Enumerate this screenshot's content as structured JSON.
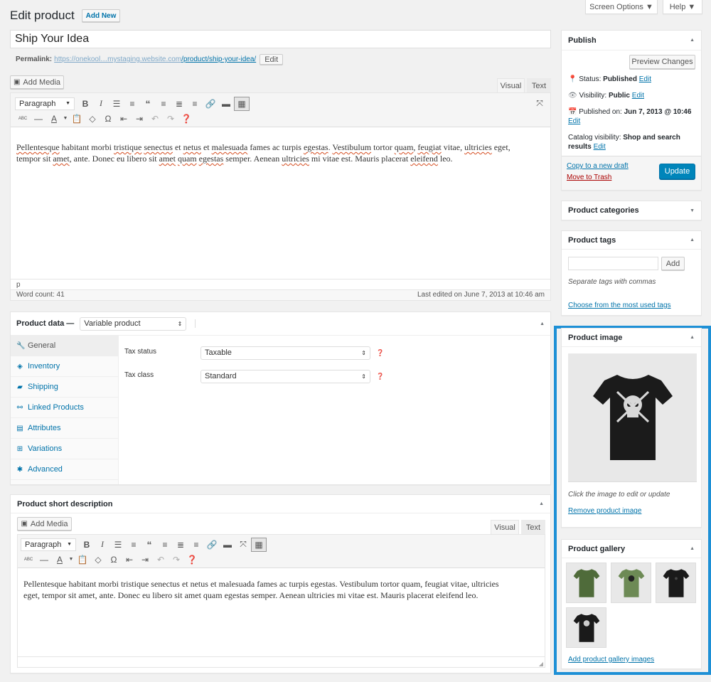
{
  "header": {
    "title": "Edit product",
    "add_new": "Add New",
    "screen_options": "Screen Options ▼",
    "help": "Help ▼"
  },
  "post": {
    "title": "Ship Your Idea",
    "permalink_label": "Permalink:",
    "permalink_base": "https://onekool…mystaging.website.com",
    "permalink_path": "/product/ship-your-idea/",
    "permalink_edit": "Edit"
  },
  "editor": {
    "add_media": "Add Media",
    "tab_visual": "Visual",
    "tab_text": "Text",
    "format_select": "Paragraph",
    "content_line1": [
      {
        "t": "Pellentesque",
        "s": true
      },
      {
        "t": " habitant morbi "
      },
      {
        "t": "tristique",
        "s": true
      },
      {
        "t": " "
      },
      {
        "t": "senectus",
        "s": true
      },
      {
        "t": " et "
      },
      {
        "t": "netus",
        "s": true
      },
      {
        "t": " et "
      },
      {
        "t": "malesuada",
        "s": true
      },
      {
        "t": " fames ac turpis "
      },
      {
        "t": "egestas",
        "s": true
      },
      {
        "t": ". "
      },
      {
        "t": "Vestibulum",
        "s": true
      },
      {
        "t": " tortor "
      },
      {
        "t": "quam",
        "s": true
      },
      {
        "t": ", "
      },
      {
        "t": "feugiat",
        "s": true
      },
      {
        "t": " vitae, "
      },
      {
        "t": "ultricies",
        "s": true
      },
      {
        "t": " eget,"
      }
    ],
    "content_line2": [
      {
        "t": "tempor sit "
      },
      {
        "t": "amet",
        "s": true
      },
      {
        "t": ", ante. Donec eu libero sit "
      },
      {
        "t": "amet",
        "s": true
      },
      {
        "t": " "
      },
      {
        "t": "quam",
        "s": true
      },
      {
        "t": " "
      },
      {
        "t": "egestas",
        "s": true
      },
      {
        "t": " semper. Aenean "
      },
      {
        "t": "ultricies",
        "s": true
      },
      {
        "t": " mi vitae est. Mauris placerat "
      },
      {
        "t": "eleifend",
        "s": true
      },
      {
        "t": " leo."
      }
    ],
    "path": "p",
    "word_count": "Word count: 41",
    "last_edited": "Last edited on June 7, 2013 at 10:46 am"
  },
  "product_data": {
    "label": "Product data —",
    "type": "Variable product",
    "tabs": [
      {
        "label": "General",
        "icon": "wrench-icon",
        "glyph": "🔧"
      },
      {
        "label": "Inventory",
        "icon": "tag-icon",
        "glyph": "◈"
      },
      {
        "label": "Shipping",
        "icon": "truck-icon",
        "glyph": "▰"
      },
      {
        "label": "Linked Products",
        "icon": "link-icon",
        "glyph": "⚯"
      },
      {
        "label": "Attributes",
        "icon": "list-card-icon",
        "glyph": "▤"
      },
      {
        "label": "Variations",
        "icon": "grid-icon",
        "glyph": "⊞"
      },
      {
        "label": "Advanced",
        "icon": "gear-icon",
        "glyph": "✱"
      }
    ],
    "fields": [
      {
        "label": "Tax status",
        "value": "Taxable"
      },
      {
        "label": "Tax class",
        "value": "Standard"
      }
    ]
  },
  "short_description": {
    "title": "Product short description",
    "add_media": "Add Media",
    "tab_visual": "Visual",
    "tab_text": "Text",
    "format_select": "Paragraph",
    "content_line1": "Pellentesque habitant morbi tristique senectus et netus et malesuada fames ac turpis egestas. Vestibulum tortor quam, feugiat vitae, ultricies",
    "content_line2": "eget, tempor sit amet, ante. Donec eu libero sit amet quam egestas semper. Aenean ultricies mi vitae est. Mauris placerat eleifend leo."
  },
  "publish": {
    "title": "Publish",
    "preview": "Preview Changes",
    "status_label": "Status:",
    "status_value": "Published",
    "visibility_label": "Visibility:",
    "visibility_value": "Public",
    "published_label": "Published on:",
    "published_value": "Jun 7, 2013 @ 10:46",
    "catalog_label": "Catalog visibility:",
    "catalog_value": "Shop and search results",
    "edit": "Edit",
    "copy_draft": "Copy to a new draft",
    "trash": "Move to Trash",
    "update": "Update"
  },
  "categories": {
    "title": "Product categories"
  },
  "tags": {
    "title": "Product tags",
    "input_value": "",
    "add": "Add",
    "hint": "Separate tags with commas",
    "choose": "Choose from the most used tags"
  },
  "product_image": {
    "title": "Product image",
    "hint": "Click the image to edit or update",
    "remove": "Remove product image"
  },
  "gallery": {
    "title": "Product gallery",
    "items": [
      {
        "shirt_color": "#4f6b3a",
        "print": "none"
      },
      {
        "shirt_color": "#6d8a55",
        "print": "dark"
      },
      {
        "shirt_color": "#1a1a1a",
        "print": "small"
      },
      {
        "shirt_color": "#1a1a1a",
        "print": "light"
      }
    ],
    "add": "Add product gallery images"
  },
  "colors": {
    "accent": "#0073aa",
    "highlight_border": "#1e90d6",
    "trash": "#a00",
    "spell": "#d54e21"
  }
}
